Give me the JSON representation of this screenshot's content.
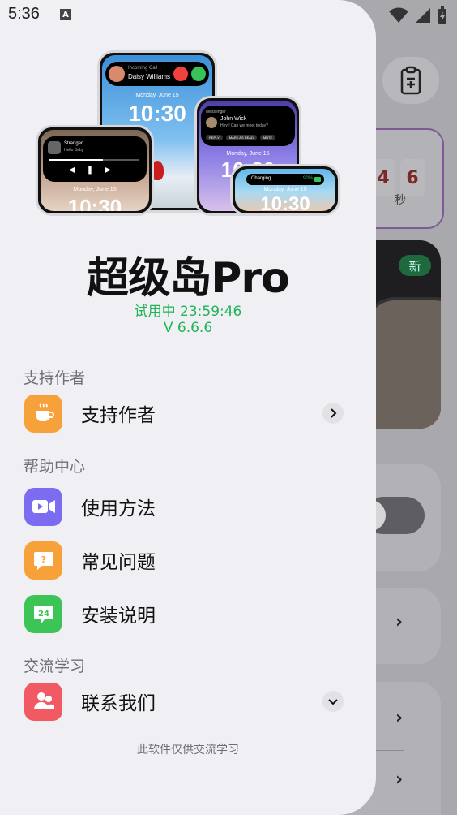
{
  "status_bar": {
    "time": "5:36",
    "a_icon": "A"
  },
  "background": {
    "timer_digits": [
      "4",
      "6"
    ],
    "timer_unit": "秒",
    "badge_new": "新"
  },
  "drawer": {
    "hero": {
      "phone1": {
        "caller_label": "Incoming Call",
        "caller_name": "Daisy Williams",
        "date": "Monday, June 15",
        "time": "10:30"
      },
      "phone2": {
        "app": "Messenger",
        "name": "John Wick",
        "message": "Hey!! Can we meet today?",
        "chips": [
          "REPLY",
          "MARK AS READ",
          "MUTE"
        ],
        "date": "Monday, June 15",
        "time": "10:30"
      },
      "phone3": {
        "song": "Stranger",
        "artist": "Hello Baby",
        "date": "Monday, June 15",
        "time": "10:30"
      },
      "phone4": {
        "charging_label": "Charging",
        "charging_pct": "90%",
        "date": "Monday, June 15",
        "time": "10:30"
      }
    },
    "app_title": "超级岛Pro",
    "trial_text": "试用中 23:59:46",
    "version": "V 6.6.6",
    "sections": {
      "support": {
        "label": "支持作者",
        "items": [
          {
            "label": "支持作者",
            "icon": "coffee-icon",
            "color": "#f7a13a"
          }
        ]
      },
      "help": {
        "label": "帮助中心",
        "items": [
          {
            "label": "使用方法",
            "icon": "video-icon",
            "color": "#7b6cf2"
          },
          {
            "label": "常见问题",
            "icon": "question-bubble-icon",
            "color": "#f7a13a"
          },
          {
            "label": "安装说明",
            "icon": "24-hours-icon",
            "color": "#3dc457"
          }
        ]
      },
      "community": {
        "label": "交流学习",
        "items": [
          {
            "label": "联系我们",
            "icon": "users-icon",
            "color": "#f25a63"
          }
        ]
      }
    },
    "footer_note": "此软件仅供交流学习"
  }
}
